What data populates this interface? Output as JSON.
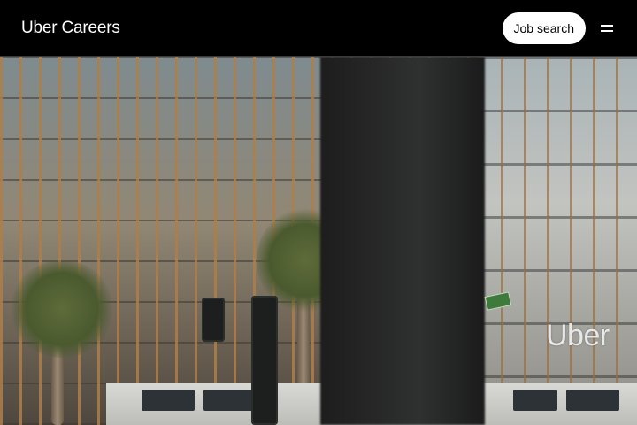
{
  "header": {
    "brand": "Uber Careers",
    "job_search_label": "Job search",
    "menu_icon": "hamburger-menu-icon"
  },
  "hero": {
    "sign_text": "Uber"
  },
  "colors": {
    "header_bg": "#000000",
    "button_bg": "#ffffff",
    "button_text": "#000000"
  }
}
